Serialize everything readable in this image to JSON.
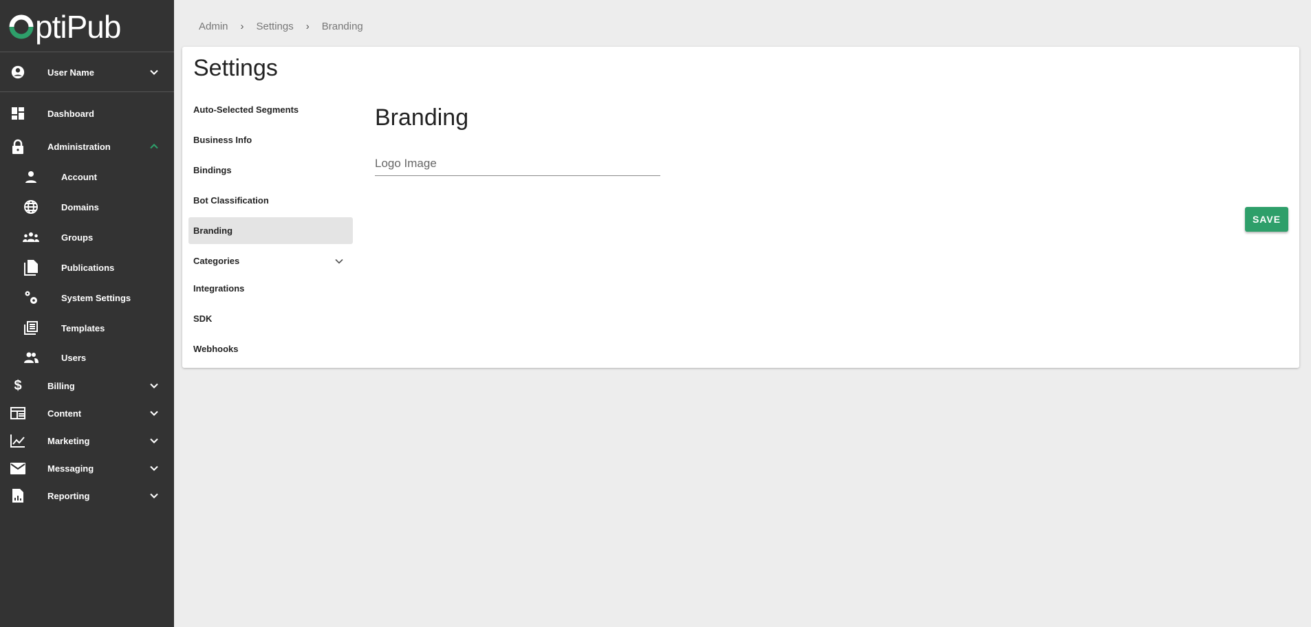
{
  "app": {
    "logo_text": "OptiPub",
    "accent": "#2e9f6a"
  },
  "sidebar": {
    "user": {
      "label": "User Name",
      "icon": "account-circle-icon"
    },
    "items": [
      {
        "label": "Dashboard",
        "icon": "dashboard-icon"
      },
      {
        "label": "Administration",
        "icon": "lock-icon",
        "expanded": true,
        "children": [
          {
            "label": "Account",
            "icon": "person-icon"
          },
          {
            "label": "Domains",
            "icon": "globe-icon"
          },
          {
            "label": "Groups",
            "icon": "groups-icon"
          },
          {
            "label": "Publications",
            "icon": "file-copy-icon"
          },
          {
            "label": "System Settings",
            "icon": "gears-icon"
          },
          {
            "label": "Templates",
            "icon": "newspaper-icon"
          },
          {
            "label": "Users",
            "icon": "people-icon"
          }
        ]
      },
      {
        "label": "Billing",
        "icon": "dollar-icon"
      },
      {
        "label": "Content",
        "icon": "web-icon"
      },
      {
        "label": "Marketing",
        "icon": "chart-line-icon"
      },
      {
        "label": "Messaging",
        "icon": "mail-icon"
      },
      {
        "label": "Reporting",
        "icon": "report-icon"
      }
    ]
  },
  "breadcrumb": [
    "Admin",
    "Settings",
    "Branding"
  ],
  "settings": {
    "title": "Settings",
    "menu": [
      "Auto-Selected Segments",
      "Business Info",
      "Bindings",
      "Bot Classification",
      "Branding",
      "Categories",
      "Integrations",
      "SDK",
      "Webhooks"
    ],
    "active": "Branding"
  },
  "branding": {
    "title": "Branding",
    "logo_field_label": "Logo Image",
    "save_label": "SAVE"
  }
}
